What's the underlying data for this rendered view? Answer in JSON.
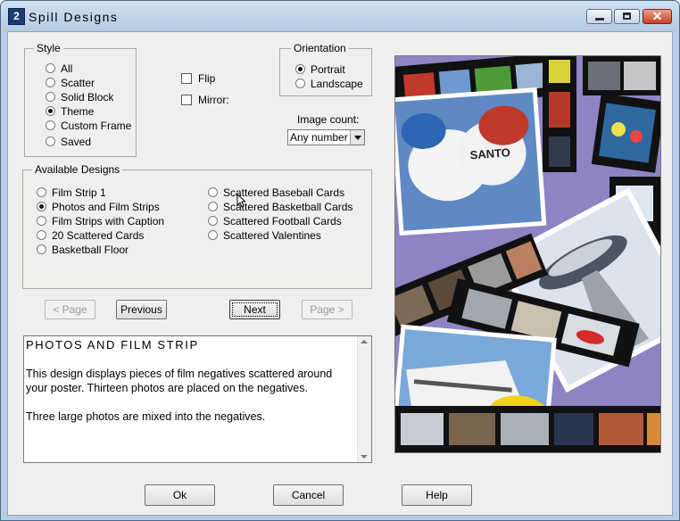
{
  "window": {
    "title": "Spill Designs"
  },
  "style_group": {
    "label": "Style",
    "options": [
      {
        "label": "All",
        "selected": false
      },
      {
        "label": "Scatter",
        "selected": false
      },
      {
        "label": "Solid Block",
        "selected": false
      },
      {
        "label": "Theme",
        "selected": true
      },
      {
        "label": "Custom Frame",
        "selected": false
      },
      {
        "label": "Saved",
        "selected": false
      }
    ]
  },
  "flip": {
    "label": "Flip",
    "checked": false
  },
  "mirror": {
    "label": "Mirror:",
    "checked": false
  },
  "orientation_group": {
    "label": "Orientation",
    "options": [
      {
        "label": "Portrait",
        "selected": true
      },
      {
        "label": "Landscape",
        "selected": false
      }
    ]
  },
  "image_count": {
    "label": "Image count:",
    "value": "Any number"
  },
  "designs_group": {
    "label": "Available Designs",
    "left": [
      {
        "label": "Film Strip 1",
        "selected": false
      },
      {
        "label": "Photos and Film Strips",
        "selected": true
      },
      {
        "label": "Film Strips with Caption",
        "selected": false
      },
      {
        "label": "20 Scattered Cards",
        "selected": false
      },
      {
        "label": "Basketball Floor",
        "selected": false
      }
    ],
    "right": [
      {
        "label": "Scattered Baseball Cards",
        "selected": false
      },
      {
        "label": "Scattered Basketball Cards",
        "selected": false
      },
      {
        "label": "Scattered Football Cards",
        "selected": false
      },
      {
        "label": "Scattered Valentines",
        "selected": false
      }
    ]
  },
  "nav": {
    "page_prev": "< Page",
    "previous": "Previous",
    "next": "Next",
    "page_next": "Page >"
  },
  "description": {
    "title": "PHOTOS AND FILM STRIP",
    "para1": "This design displays pieces of film negatives scattered around your poster.  Thirteen photos are placed on the negatives.",
    "para2": "Three large photos are mixed into the negatives."
  },
  "preview": {
    "photos": [
      "cap-santorini",
      "space-needle",
      "cruise-ship"
    ],
    "colors": {
      "background": "#8f83c4",
      "film": "#111111"
    }
  },
  "footer": {
    "ok": "Ok",
    "cancel": "Cancel",
    "help": "Help"
  }
}
